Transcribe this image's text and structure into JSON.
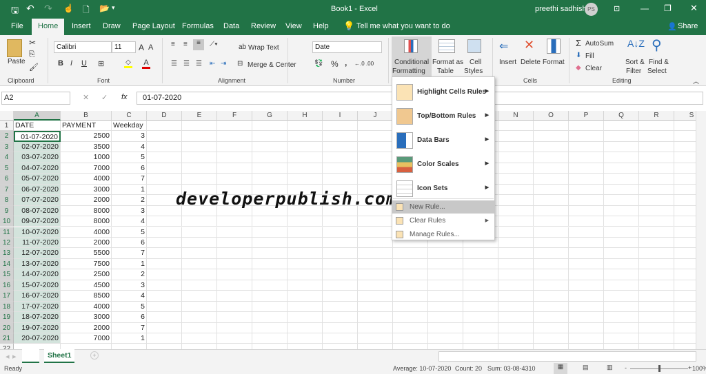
{
  "title": {
    "doc": "Book1  -  Excel",
    "user": "preethi sadhish",
    "initials": "PS",
    "qat_icons": [
      "save-icon",
      "undo-icon",
      "redo-icon",
      "touch-mode-icon",
      "new-file-icon",
      "open-folder-icon",
      "customize-qat-icon"
    ]
  },
  "tabs": [
    "File",
    "Home",
    "Insert",
    "Draw",
    "Page Layout",
    "Formulas",
    "Data",
    "Review",
    "View",
    "Help"
  ],
  "tell_me": "Tell me what you want to do",
  "share": "Share",
  "ribbon": {
    "clipboard": {
      "label": "Clipboard",
      "paste": "Paste"
    },
    "font": {
      "label": "Font",
      "name": "Calibri",
      "size": "11",
      "bold": "B",
      "italic": "I",
      "underline": "U"
    },
    "alignment": {
      "label": "Alignment",
      "wrap": "Wrap Text",
      "merge": "Merge & Center"
    },
    "number": {
      "label": "Number",
      "format": "Date",
      "percent": "%",
      "comma": ","
    },
    "styles": {
      "conditional": "Conditional",
      "conditional2": "Formatting",
      "format_table": "Format as",
      "format_table2": "Table",
      "cell_styles": "Cell",
      "cell_styles2": "Styles"
    },
    "cells": {
      "label": "Cells",
      "insert": "Insert",
      "delete": "Delete",
      "format": "Format"
    },
    "editing": {
      "label": "Editing",
      "autosum": "AutoSum",
      "fill": "Fill",
      "clear": "Clear",
      "sort": "Sort &",
      "sort2": "Filter",
      "find": "Find &",
      "find2": "Select"
    }
  },
  "formula_bar": {
    "name_box": "A2",
    "fx": "fx",
    "value": "01-07-2020"
  },
  "columns": [
    "A",
    "B",
    "C",
    "D",
    "E",
    "F",
    "G",
    "H",
    "I",
    "J",
    "K",
    "L",
    "M",
    "N",
    "O",
    "P",
    "Q",
    "R",
    "S"
  ],
  "header_row": [
    "DATE",
    "PAYMENT",
    "Weekday"
  ],
  "rows": [
    [
      "01-07-2020",
      "2500",
      "3"
    ],
    [
      "02-07-2020",
      "3500",
      "4"
    ],
    [
      "03-07-2020",
      "1000",
      "5"
    ],
    [
      "04-07-2020",
      "7000",
      "6"
    ],
    [
      "05-07-2020",
      "4000",
      "7"
    ],
    [
      "06-07-2020",
      "3000",
      "1"
    ],
    [
      "07-07-2020",
      "2000",
      "2"
    ],
    [
      "08-07-2020",
      "8000",
      "3"
    ],
    [
      "09-07-2020",
      "8000",
      "4"
    ],
    [
      "10-07-2020",
      "4000",
      "5"
    ],
    [
      "11-07-2020",
      "2000",
      "6"
    ],
    [
      "12-07-2020",
      "5500",
      "7"
    ],
    [
      "13-07-2020",
      "7500",
      "1"
    ],
    [
      "14-07-2020",
      "2500",
      "2"
    ],
    [
      "15-07-2020",
      "4500",
      "3"
    ],
    [
      "16-07-2020",
      "8500",
      "4"
    ],
    [
      "17-07-2020",
      "4000",
      "5"
    ],
    [
      "18-07-2020",
      "3000",
      "6"
    ],
    [
      "19-07-2020",
      "2000",
      "7"
    ],
    [
      "20-07-2020",
      "7000",
      "1"
    ]
  ],
  "menu": {
    "items": [
      "Highlight Cells Rules",
      "Top/Bottom Rules",
      "Data Bars",
      "Color Scales",
      "Icon Sets"
    ],
    "small": [
      "New Rule...",
      "Clear Rules",
      "Manage Rules..."
    ]
  },
  "watermark": "developerpublish.com",
  "sheet": "Sheet1",
  "status": {
    "ready": "Ready",
    "average": "Average: 10-07-2020",
    "count": "Count: 20",
    "sum": "Sum: 03-08-4310",
    "zoom": "100%"
  },
  "colors": {
    "brand": "#217346",
    "selection": "#d3e3dc"
  }
}
